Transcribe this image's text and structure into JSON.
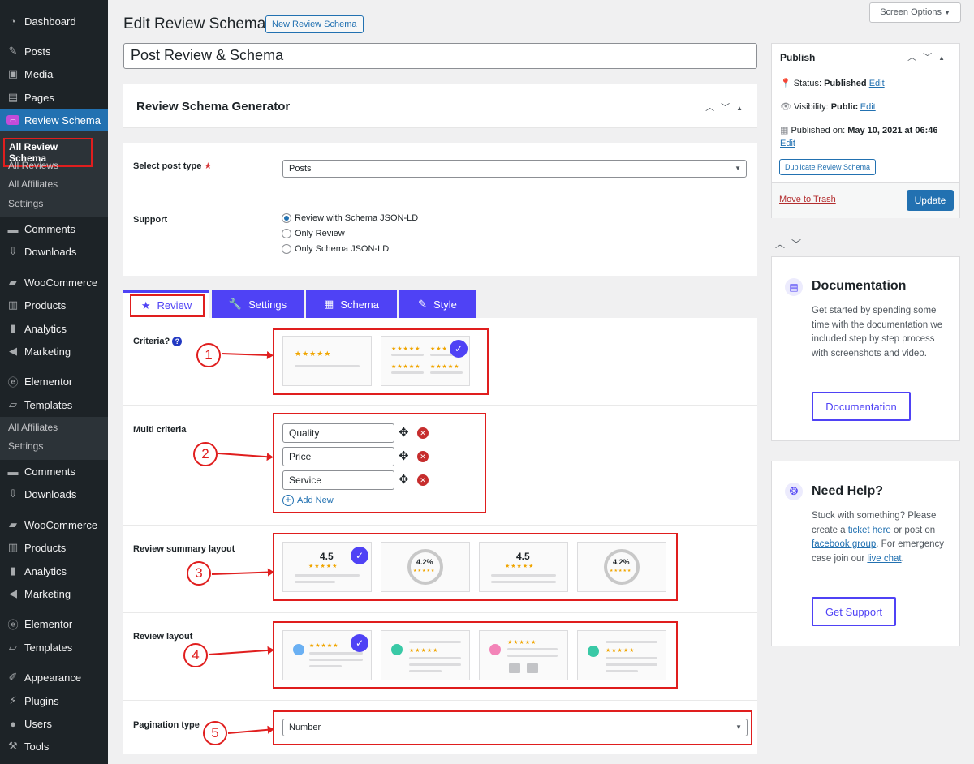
{
  "sidebar": {
    "items": [
      {
        "label": "Dashboard",
        "icon": "dashboard-icon"
      },
      {
        "label": "Posts",
        "icon": "pin-icon"
      },
      {
        "label": "Media",
        "icon": "media-icon"
      },
      {
        "label": "Pages",
        "icon": "pages-icon"
      },
      {
        "label": "Review Schema",
        "icon": "review-schema-icon"
      },
      {
        "label": "Comments",
        "icon": "comment-icon"
      },
      {
        "label": "Downloads",
        "icon": "download-icon"
      },
      {
        "label": "WooCommerce",
        "icon": "woo-icon"
      },
      {
        "label": "Products",
        "icon": "products-icon"
      },
      {
        "label": "Analytics",
        "icon": "analytics-icon"
      },
      {
        "label": "Marketing",
        "icon": "megaphone-icon"
      },
      {
        "label": "Elementor",
        "icon": "elementor-icon"
      },
      {
        "label": "Templates",
        "icon": "folder-icon"
      },
      {
        "label": "Comments",
        "icon": "comment-icon"
      },
      {
        "label": "Downloads",
        "icon": "download-icon"
      },
      {
        "label": "WooCommerce",
        "icon": "woo-icon"
      },
      {
        "label": "Products",
        "icon": "products-icon"
      },
      {
        "label": "Analytics",
        "icon": "analytics-icon"
      },
      {
        "label": "Marketing",
        "icon": "megaphone-icon"
      },
      {
        "label": "Elementor",
        "icon": "elementor-icon"
      },
      {
        "label": "Templates",
        "icon": "folder-icon"
      },
      {
        "label": "Appearance",
        "icon": "brush-icon"
      },
      {
        "label": "Plugins",
        "icon": "plugin-icon"
      },
      {
        "label": "Users",
        "icon": "user-icon"
      },
      {
        "label": "Tools",
        "icon": "wrench-icon"
      }
    ],
    "submenu1": [
      "All Review Schema",
      "All Reviews",
      "All Affiliates",
      "Settings"
    ],
    "submenu2": [
      "All Affiliates",
      "Settings"
    ]
  },
  "header": {
    "title": "Edit Review Schema",
    "new_button": "New Review Schema",
    "screen_options": "Screen Options"
  },
  "post_title": "Post Review & Schema",
  "generator": {
    "title": "Review Schema Generator",
    "select_post_type_label": "Select post type",
    "select_post_type_value": "Posts",
    "support_label": "Support",
    "support_options": [
      "Review with Schema JSON-LD",
      "Only Review",
      "Only Schema JSON-LD"
    ],
    "support_selected": 0,
    "tabs": [
      "Review",
      "Settings",
      "Schema",
      "Style"
    ],
    "active_tab": "Review",
    "criteria_label": "Criteria?",
    "multi_criteria_label": "Multi criteria",
    "criteria_items": [
      "Quality",
      "Price",
      "Service"
    ],
    "add_new": "Add New",
    "summary_label": "Review summary layout",
    "summary_values": [
      "4.5",
      "4.2%",
      "4.5",
      "4.2%"
    ],
    "review_layout_label": "Review layout",
    "pagination_label": "Pagination type",
    "pagination_value": "Number",
    "annotations": [
      "1",
      "2",
      "3",
      "4",
      "5"
    ]
  },
  "publish": {
    "title": "Publish",
    "status_label": "Status:",
    "status_value": "Published",
    "visibility_label": "Visibility:",
    "visibility_value": "Public",
    "published_label": "Published on:",
    "published_value": "May 10, 2021 at 06:46",
    "edit": "Edit",
    "duplicate": "Duplicate Review Schema",
    "trash": "Move to Trash",
    "update": "Update"
  },
  "documentation": {
    "title": "Documentation",
    "text": "Get started by spending some time with the documentation we included step by step process with screenshots and video.",
    "button": "Documentation"
  },
  "help": {
    "title": "Need Help?",
    "t1": "Stuck with something? Please create a ",
    "link1": "ticket here",
    "t2": " or post on ",
    "link2": "facebook group",
    "t3": ". For emergency case join our ",
    "link3": "live chat",
    "t4": ".",
    "button": "Get Support"
  },
  "colors": {
    "accent": "#4f42f5",
    "wp_blue": "#2271b1",
    "annotation_red": "#e01e1e",
    "star": "#f0a500"
  }
}
